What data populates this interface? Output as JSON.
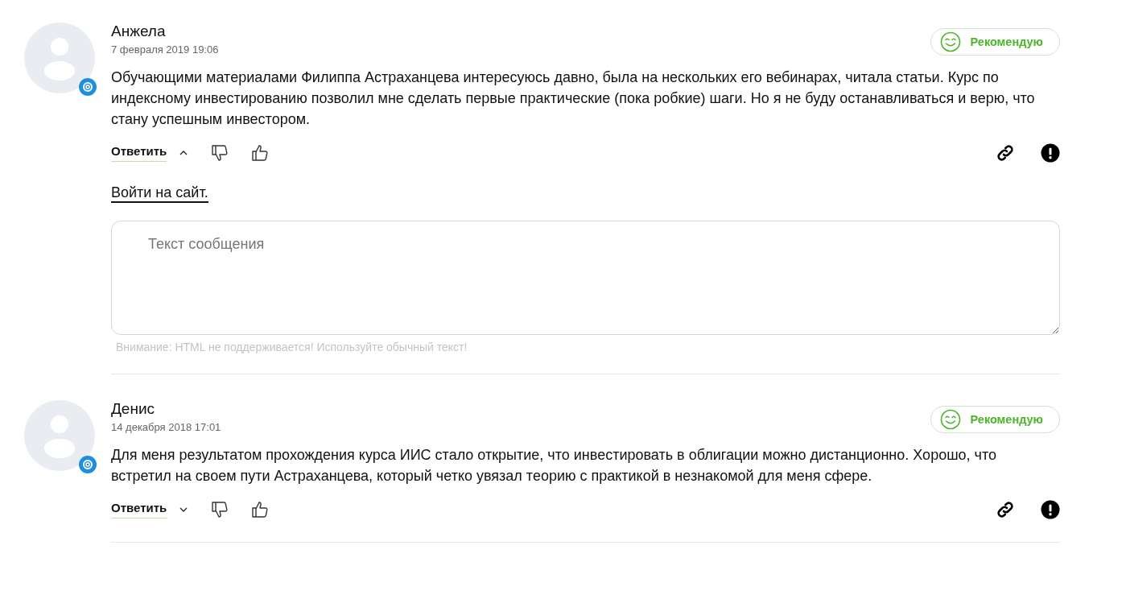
{
  "comments": [
    {
      "author": "Анжела",
      "date": "7 февраля 2019 19:06",
      "badge": "Рекомендую",
      "text": "Обучающими материалами Филиппа Астраханцева интересуюсь давно, была на нескольких его вебинарах, читала статьи. Курс по индексному инвестированию позволил мне сделать первые практические (пока робкие) шаги. Но я не буду останавливаться и верю, что стану успешным инвестором.",
      "reply_label": "Ответить",
      "expanded": true,
      "reply_form": {
        "login_link": "Войти на сайт.",
        "placeholder": "Текст сообщения",
        "note": "Внимание: HTML не поддерживается! Используйте обычный текст!"
      }
    },
    {
      "author": "Денис",
      "date": "14 декабря 2018 17:01",
      "badge": "Рекомендую",
      "text": "Для меня результатом прохождения курса ИИС стало открытие, что инвестировать в облигации можно дистанционно. Хорошо, что встретил на своем пути Астраханцева, который четко увязал теорию с практикой в незнакомой для меня сфере.",
      "reply_label": "Ответить",
      "expanded": false
    }
  ]
}
